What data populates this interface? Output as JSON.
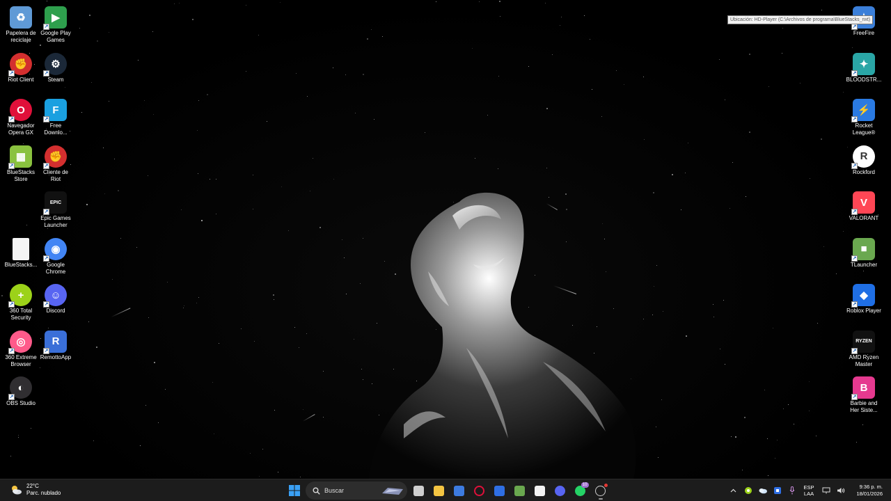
{
  "desktop": {
    "icons_left": [
      {
        "label": "Papelera de\nreciclaje",
        "icon": "recycle-bin-icon",
        "color": "#5f9ad6"
      },
      {
        "label": "Google Play\nGames",
        "icon": "google-play-games-icon",
        "color": "#2e9f4d"
      },
      {
        "label": "Riot Client",
        "icon": "riot-client-icon",
        "color": "#d32f2f"
      },
      {
        "label": "Steam",
        "icon": "steam-icon",
        "color": "#1b2838"
      },
      {
        "label": "Navegador\nOpera GX",
        "icon": "opera-gx-icon",
        "color": "#e0103a"
      },
      {
        "label": "Free\nDownlo...",
        "icon": "free-download-manager-icon",
        "color": "#1aa0e0"
      },
      {
        "label": "BlueStacks\nStore",
        "icon": "bluestacks-store-icon",
        "color": "#8ac23f"
      },
      {
        "label": "Cliente de\nRiot",
        "icon": "riot-client-icon",
        "color": "#d32f2f"
      },
      {
        "label": "Epic Games\nLauncher",
        "icon": "epic-games-icon",
        "color": "#111111"
      },
      {
        "label": "BlueStacks...",
        "icon": "document-icon",
        "color": "#f5f5f5"
      },
      {
        "label": "Google\nChrome",
        "icon": "chrome-icon",
        "color": "#4285f4"
      },
      {
        "label": "360 Total\nSecurity",
        "icon": "360-total-security-icon",
        "color": "#9cd219"
      },
      {
        "label": "Discord",
        "icon": "discord-icon",
        "color": "#5865f2"
      },
      {
        "label": "360 Extreme\nBrowser",
        "icon": "360-browser-icon",
        "color": "#ff5a8a"
      },
      {
        "label": "RemottoApp",
        "icon": "remotto-app-icon",
        "color": "#3a6fd8"
      },
      {
        "label": "OBS Studio",
        "icon": "obs-studio-icon",
        "color": "#302e31"
      }
    ],
    "icons_right": [
      {
        "label": "FreeFire",
        "icon": "freefire-icon",
        "color": "#3b7fd9"
      },
      {
        "label": "BLOODSTR...",
        "icon": "bloodstrike-icon",
        "color": "#2aa6a6"
      },
      {
        "label": "Rocket\nLeague®",
        "icon": "rocket-league-icon",
        "color": "#2a7ae2"
      },
      {
        "label": "Rockford",
        "icon": "rockford-icon",
        "color": "#ffffff"
      },
      {
        "label": "VALORANT",
        "icon": "valorant-icon",
        "color": "#ff4655"
      },
      {
        "label": "TLauncher",
        "icon": "tlauncher-icon",
        "color": "#6aa84f"
      },
      {
        "label": "Roblox Player",
        "icon": "roblox-icon",
        "color": "#1f6fe5"
      },
      {
        "label": "AMD Ryzen\nMaster",
        "icon": "amd-ryzen-icon",
        "color": "#111111"
      },
      {
        "label": "Barbie and\nHer Siste...",
        "icon": "barbie-icon",
        "color": "#e5398f"
      }
    ],
    "tooltip": "Ubicación: HD-Player (C:\\Archivos de programa\\BlueStacks_nxt)"
  },
  "taskbar": {
    "weather": {
      "temp": "22°C",
      "desc": "Parc. nublado"
    },
    "search_label": "Buscar",
    "apps": [
      {
        "name": "task-view-icon",
        "color": "#cfcfcf",
        "running": false
      },
      {
        "name": "file-explorer-icon",
        "color": "#f4c542",
        "running": false
      },
      {
        "name": "snipping-tool-icon",
        "color": "#3d7be0",
        "running": false
      },
      {
        "name": "opera-gx-icon",
        "color": "#e0103a",
        "running": false
      },
      {
        "name": "remotto-icon",
        "color": "#2f6fe4",
        "running": false
      },
      {
        "name": "minecraft-icon",
        "color": "#6aa84f",
        "running": false
      },
      {
        "name": "notepad-icon",
        "color": "#f2f2f2",
        "running": false
      },
      {
        "name": "discord-icon",
        "color": "#5865f2",
        "running": false
      },
      {
        "name": "whatsapp-icon",
        "color": "#25d366",
        "running": false,
        "badge": "10"
      },
      {
        "name": "obs-studio-icon",
        "color": "#cfcfcf",
        "running": true
      }
    ],
    "tray": {
      "lang_top": "ESP",
      "lang_bottom": "LAA",
      "time": "9:36 p. m.",
      "date": "18/01/2026"
    }
  }
}
